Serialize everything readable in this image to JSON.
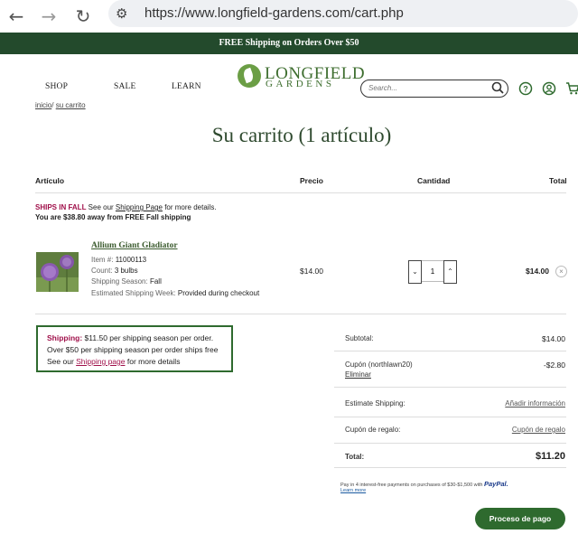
{
  "browser": {
    "url": "https://www.longfield-gardens.com/cart.php"
  },
  "promo": {
    "text": "FREE Shipping on Orders Over $50"
  },
  "nav": {
    "shop": "SHOP",
    "sale": "SALE",
    "learn": "LEARN"
  },
  "logo": {
    "top": "LONGFIELD",
    "bottom": "GARDENS"
  },
  "search": {
    "placeholder": "Search..."
  },
  "breadcrumb": {
    "home": "inicio",
    "sep": "/",
    "current": "su carrito"
  },
  "title": "Su carrito (1 artículo)",
  "table_headers": {
    "item": "Artículo",
    "price": "Precio",
    "quantity": "Cantidad",
    "total": "Total"
  },
  "notice": {
    "ships_label": "SHIPS IN FALL",
    "see_our": " See our ",
    "shipping_page": "Shipping Page",
    "more_details": " for more details.",
    "away": "You are $38.80 away from FREE Fall shipping"
  },
  "product": {
    "name": "Allium Giant Gladiator",
    "item_label": "Item #:",
    "item_value": "11000113",
    "count_label": "Count:",
    "count_value": "3 bulbs",
    "season_label": "Shipping Season:",
    "season_value": "Fall",
    "week_label": "Estimated Shipping Week:",
    "week_value": "Provided during checkout",
    "price": "$14.00",
    "quantity": "1",
    "line_total": "$14.00"
  },
  "shipping_box": {
    "label": "Shipping:",
    "line1_rest": " $11.50  per shipping season per order.",
    "line2": "Over $50 per shipping season per order ships free",
    "line3_pre": "See our ",
    "line3_link": "Shipping page",
    "line3_post": " for more details"
  },
  "summary": {
    "subtotal_label": "Subtotal:",
    "subtotal_value": "$14.00",
    "coupon_label": "Cupón (northlawn20)",
    "coupon_remove": "Eliminar",
    "coupon_value": "-$2.80",
    "estimate_label": "Estimate Shipping:",
    "estimate_link": "Añadir información",
    "gift_label": "Cupón de regalo:",
    "gift_link": "Cupón de regalo",
    "total_label": "Total:",
    "total_value": "$11.20"
  },
  "paypal": {
    "text": "Pay in 4 interest-free payments on purchases of $30-$1,500 with ",
    "brand": "PayPal.",
    "learn_more": "Learn more"
  },
  "checkout": {
    "label": "Proceso de pago"
  },
  "colors": {
    "brand_green": "#234a2c",
    "accent_red": "#a0104a",
    "button_green": "#2e6a2e"
  }
}
